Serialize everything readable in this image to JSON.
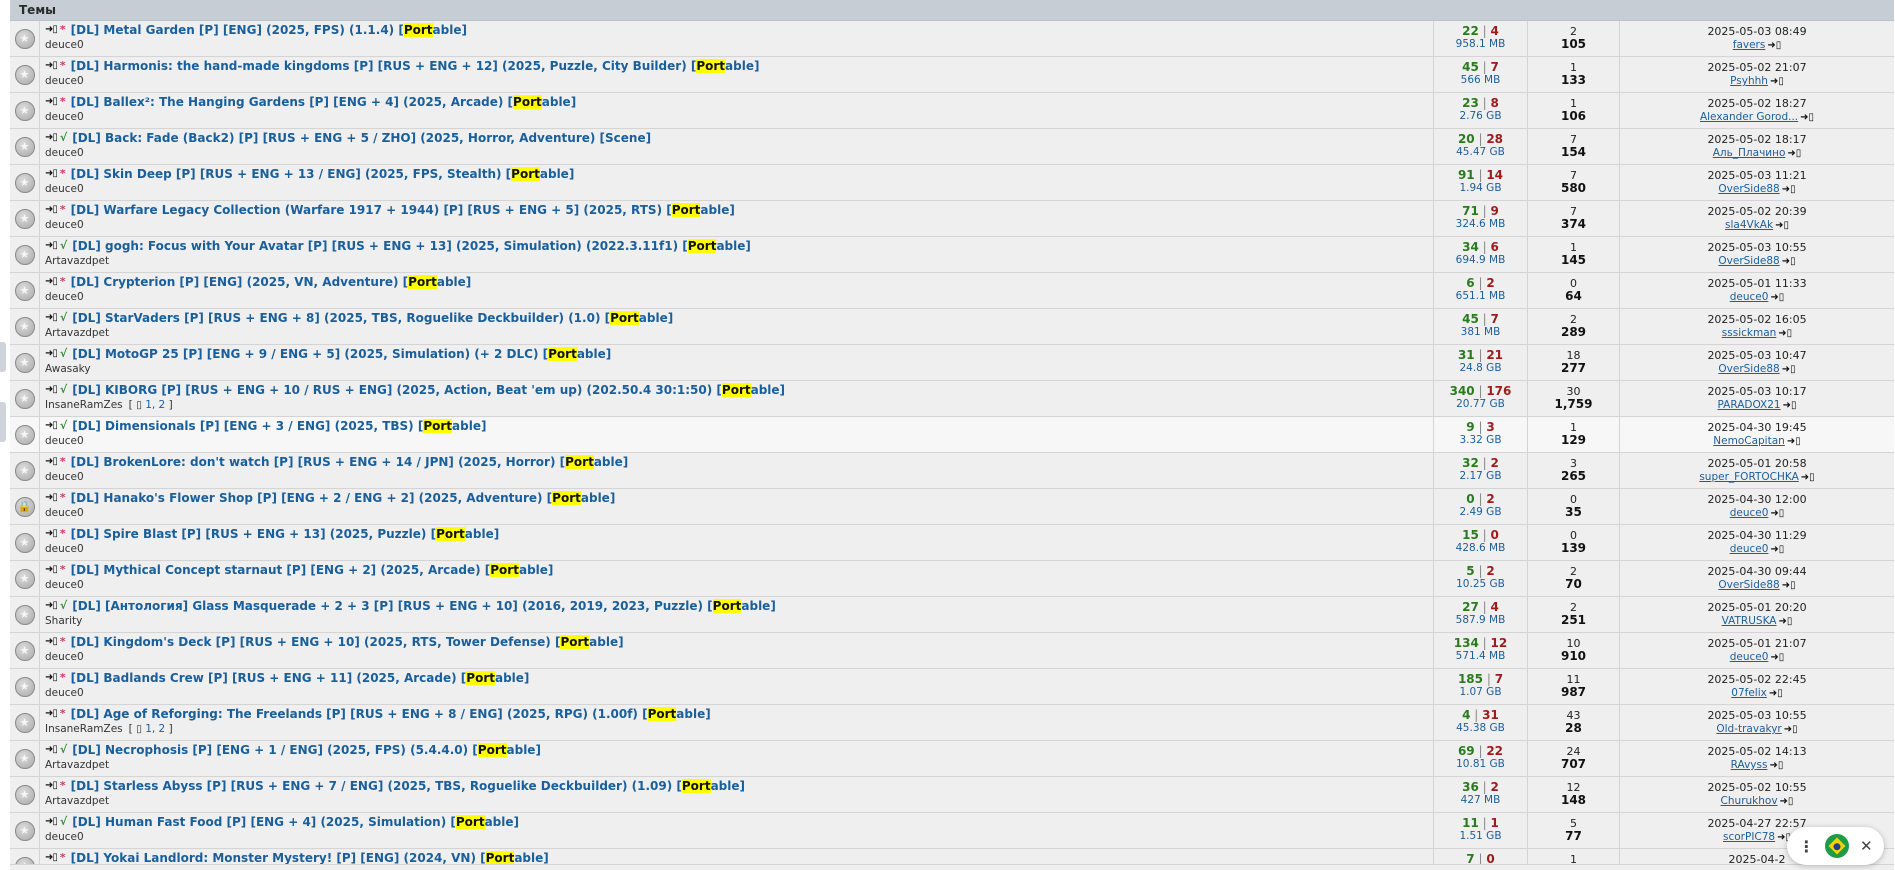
{
  "section_title": "Темы",
  "rows": [
    {
      "icon": "★",
      "status": "*",
      "st": "pink",
      "title": "[DL] Metal Garden [P] [ENG] (2025, FPS) (1.1.4) [",
      "hl": "Port",
      "tail": "able]",
      "author": "deuce0",
      "pages": "",
      "seeds": "22",
      "leech": "4",
      "size": "958.1 MB",
      "replies": "2",
      "downloads": "105",
      "date": "2025-05-03 08:49",
      "user": "favers"
    },
    {
      "icon": "★",
      "status": "*",
      "st": "pink",
      "title": "[DL] Harmonis: the hand-made kingdoms [P] [RUS + ENG + 12] (2025, Puzzle, City Builder) [",
      "hl": "Port",
      "tail": "able]",
      "author": "deuce0",
      "pages": "",
      "seeds": "45",
      "leech": "7",
      "size": "566 MB",
      "replies": "1",
      "downloads": "133",
      "date": "2025-05-02 21:07",
      "user": "Psyhhh"
    },
    {
      "icon": "★",
      "status": "*",
      "st": "pink",
      "title": "[DL] Ballex²: The Hanging Gardens [P] [ENG + 4] (2025, Arcade) [",
      "hl": "Port",
      "tail": "able]",
      "author": "deuce0",
      "pages": "",
      "seeds": "23",
      "leech": "8",
      "size": "2.76 GB",
      "replies": "1",
      "downloads": "106",
      "date": "2025-05-02 18:27",
      "user": "Alexander Gorod..."
    },
    {
      "icon": "★",
      "status": "√",
      "st": "green",
      "title": "[DL] Back: Fade (Back2) [P] [RUS + ENG + 5 / ZHO] (2025, Horror, Adventure) [Scene]",
      "hl": "",
      "tail": "",
      "author": "deuce0",
      "pages": "",
      "seeds": "20",
      "leech": "28",
      "size": "45.47 GB",
      "replies": "7",
      "downloads": "154",
      "date": "2025-05-02 18:17",
      "user": "Аль_Плачино"
    },
    {
      "icon": "★",
      "status": "*",
      "st": "pink",
      "title": "[DL] Skin Deep [P] [RUS + ENG + 13 / ENG] (2025, FPS, Stealth) [",
      "hl": "Port",
      "tail": "able]",
      "author": "deuce0",
      "pages": "",
      "seeds": "91",
      "leech": "14",
      "size": "1.94 GB",
      "replies": "7",
      "downloads": "580",
      "date": "2025-05-03 11:21",
      "user": "OverSide88"
    },
    {
      "icon": "★",
      "status": "*",
      "st": "pink",
      "title": "[DL] Warfare Legacy Collection (Warfare 1917 + 1944) [P] [RUS + ENG + 5] (2025, RTS) [",
      "hl": "Port",
      "tail": "able]",
      "author": "deuce0",
      "pages": "",
      "seeds": "71",
      "leech": "9",
      "size": "324.6 MB",
      "replies": "7",
      "downloads": "374",
      "date": "2025-05-02 20:39",
      "user": "sla4VkAk"
    },
    {
      "icon": "★",
      "status": "√",
      "st": "green",
      "title": "[DL] gogh: Focus with Your Avatar [P] [RUS + ENG + 13] (2025, Simulation) (2022.3.11f1) [",
      "hl": "Port",
      "tail": "able]",
      "author": "Artavazdpet",
      "pages": "",
      "seeds": "34",
      "leech": "6",
      "size": "694.9 MB",
      "replies": "1",
      "downloads": "145",
      "date": "2025-05-03 10:55",
      "user": "OverSide88"
    },
    {
      "icon": "★",
      "status": "*",
      "st": "pink",
      "title": "[DL] Crypterion [P] [ENG] (2025, VN, Adventure) [",
      "hl": "Port",
      "tail": "able]",
      "author": "deuce0",
      "pages": "",
      "seeds": "6",
      "leech": "2",
      "size": "651.1 MB",
      "replies": "0",
      "downloads": "64",
      "date": "2025-05-01 11:33",
      "user": "deuce0"
    },
    {
      "icon": "★",
      "status": "√",
      "st": "green",
      "title": "[DL] StarVaders [P] [RUS + ENG + 8] (2025, TBS, Roguelike Deckbuilder) (1.0) [",
      "hl": "Port",
      "tail": "able]",
      "author": "Artavazdpet",
      "pages": "",
      "seeds": "45",
      "leech": "7",
      "size": "381 MB",
      "replies": "2",
      "downloads": "289",
      "date": "2025-05-02 16:05",
      "user": "sssickman"
    },
    {
      "icon": "★",
      "status": "√",
      "st": "green",
      "title": "[DL] MotoGP 25 [P] [ENG + 9 / ENG + 5] (2025, Simulation) (+ 2 DLC) [",
      "hl": "Port",
      "tail": "able]",
      "author": "Awasaky",
      "pages": "",
      "seeds": "31",
      "leech": "21",
      "size": "24.8 GB",
      "replies": "18",
      "downloads": "277",
      "date": "2025-05-03 10:47",
      "user": "OverSide88"
    },
    {
      "icon": "★",
      "status": "√",
      "st": "green",
      "title": "[DL] KIBORG [P] [RUS + ENG + 10 / RUS + ENG] (2025, Action, Beat 'em up) (202.50.4 30:1:50) [",
      "hl": "Port",
      "tail": "able]",
      "author": "InsaneRamZes",
      "pages": "1, 2",
      "seeds": "340",
      "leech": "176",
      "size": "20.77 GB",
      "replies": "30",
      "downloads": "1,759",
      "date": "2025-05-03 10:17",
      "user": "PARADOX21"
    },
    {
      "icon": "★",
      "status": "√",
      "st": "green",
      "title": "[DL] Dimensionals [P] [ENG + 3 / ENG] (2025, TBS) [",
      "hl": "Port",
      "tail": "able]",
      "author": "deuce0",
      "pages": "",
      "seeds": "9",
      "leech": "3",
      "size": "3.32 GB",
      "replies": "1",
      "downloads": "129",
      "date": "2025-04-30 19:45",
      "user": "NemoCapitan",
      "row_hl": true
    },
    {
      "icon": "★",
      "status": "*",
      "st": "pink",
      "title": "[DL] BrokenLore: don't watch [P] [RUS + ENG + 14 / JPN] (2025, Horror) [",
      "hl": "Port",
      "tail": "able]",
      "author": "deuce0",
      "pages": "",
      "seeds": "32",
      "leech": "2",
      "size": "2.17 GB",
      "replies": "3",
      "downloads": "265",
      "date": "2025-05-01 20:58",
      "user": "super_FORTOCHKA"
    },
    {
      "icon": "🔒",
      "status": "*",
      "st": "pink",
      "title": "[DL] Hanako's Flower Shop [P] [ENG + 2 / ENG + 2] (2025, Adventure) [",
      "hl": "Port",
      "tail": "able]",
      "author": "deuce0",
      "pages": "",
      "seeds": "0",
      "leech": "2",
      "size": "2.49 GB",
      "replies": "0",
      "downloads": "35",
      "date": "2025-04-30 12:00",
      "user": "deuce0"
    },
    {
      "icon": "★",
      "status": "*",
      "st": "pink",
      "title": "[DL] Spire Blast [P] [RUS + ENG + 13] (2025, Puzzle) [",
      "hl": "Port",
      "tail": "able]",
      "author": "deuce0",
      "pages": "",
      "seeds": "15",
      "leech": "0",
      "size": "428.6 MB",
      "replies": "0",
      "downloads": "139",
      "date": "2025-04-30 11:29",
      "user": "deuce0"
    },
    {
      "icon": "★",
      "status": "*",
      "st": "pink",
      "title": "[DL] Mythical Concept starnaut [P] [ENG + 2] (2025, Arcade) [",
      "hl": "Port",
      "tail": "able]",
      "author": "deuce0",
      "pages": "",
      "seeds": "5",
      "leech": "2",
      "size": "10.25 GB",
      "replies": "2",
      "downloads": "70",
      "date": "2025-04-30 09:44",
      "user": "OverSide88"
    },
    {
      "icon": "★",
      "status": "√",
      "st": "green",
      "title": "[DL] [Антология] Glass Masquerade + 2 + 3 [P] [RUS + ENG + 10] (2016, 2019, 2023, Puzzle) [",
      "hl": "Port",
      "tail": "able]",
      "author": "Sharity",
      "pages": "",
      "seeds": "27",
      "leech": "4",
      "size": "587.9 MB",
      "replies": "2",
      "downloads": "251",
      "date": "2025-05-01 20:20",
      "user": "VATRUSKA"
    },
    {
      "icon": "★",
      "status": "*",
      "st": "pink",
      "title": "[DL] Kingdom's Deck [P] [RUS + ENG + 10] (2025, RTS, Tower Defense) [",
      "hl": "Port",
      "tail": "able]",
      "author": "deuce0",
      "pages": "",
      "seeds": "134",
      "leech": "12",
      "size": "571.4 MB",
      "replies": "10",
      "downloads": "910",
      "date": "2025-05-01 21:07",
      "user": "deuce0"
    },
    {
      "icon": "★",
      "status": "*",
      "st": "pink",
      "title": "[DL] Badlands Crew [P] [RUS + ENG + 11] (2025, Arcade) [",
      "hl": "Port",
      "tail": "able]",
      "author": "deuce0",
      "pages": "",
      "seeds": "185",
      "leech": "7",
      "size": "1.07 GB",
      "replies": "11",
      "downloads": "987",
      "date": "2025-05-02 22:45",
      "user": "07felix"
    },
    {
      "icon": "★",
      "status": "*",
      "st": "pink",
      "title": "[DL] Age of Reforging: The Freelands [P] [RUS + ENG + 8 / ENG] (2025, RPG) (1.00f) [",
      "hl": "Port",
      "tail": "able]",
      "author": "InsaneRamZes",
      "pages": "1, 2",
      "seeds": "4",
      "leech": "31",
      "size": "45.38 GB",
      "replies": "43",
      "downloads": "28",
      "date": "2025-05-03 10:55",
      "user": "Old-travakyr"
    },
    {
      "icon": "★",
      "status": "√",
      "st": "green",
      "title": "[DL] Necrophosis [P] [ENG + 1 / ENG] (2025, FPS) (5.4.4.0) [",
      "hl": "Port",
      "tail": "able]",
      "author": "Artavazdpet",
      "pages": "",
      "seeds": "69",
      "leech": "22",
      "size": "10.81 GB",
      "replies": "24",
      "downloads": "707",
      "date": "2025-05-02 14:13",
      "user": "RAvyss"
    },
    {
      "icon": "★",
      "status": "*",
      "st": "pink",
      "title": "[DL] Starless Abyss [P] [RUS + ENG + 7 / ENG] (2025, TBS, Roguelike Deckbuilder) (1.09) [",
      "hl": "Port",
      "tail": "able]",
      "author": "Artavazdpet",
      "pages": "",
      "seeds": "36",
      "leech": "2",
      "size": "427 MB",
      "replies": "12",
      "downloads": "148",
      "date": "2025-05-02 10:55",
      "user": "Churukhov"
    },
    {
      "icon": "★",
      "status": "√",
      "st": "green",
      "title": "[DL] Human Fast Food [P] [ENG + 4] (2025, Simulation) [",
      "hl": "Port",
      "tail": "able]",
      "author": "deuce0",
      "pages": "",
      "seeds": "11",
      "leech": "1",
      "size": "1.51 GB",
      "replies": "5",
      "downloads": "77",
      "date": "2025-04-27 22:57",
      "user": "scorPIC78"
    },
    {
      "icon": "★",
      "status": "*",
      "st": "pink",
      "title": "[DL] Yokai Landlord: Monster Mystery! [P] [ENG] (2024, VN) [",
      "hl": "Port",
      "tail": "able]",
      "author": "deuce0",
      "pages": "",
      "seeds": "7",
      "leech": "0",
      "size": "492.9 MB",
      "replies": "1",
      "downloads": "88",
      "date": "2025-04-2",
      "user": "sssickr"
    }
  ],
  "popup": {
    "menu_icon": "kebab-icon",
    "flag_icon": "brazil-flag-icon",
    "close_icon": "close-icon",
    "close_glyph": "✕",
    "kebab_glyph": "⋮"
  },
  "colors": {
    "header_bg": "#c6cdd5",
    "row_bg": "#efefef",
    "link": "#1a5e9a",
    "seed": "#2a7a1f",
    "leech": "#9b1c1c",
    "highlight": "#ffff00"
  }
}
